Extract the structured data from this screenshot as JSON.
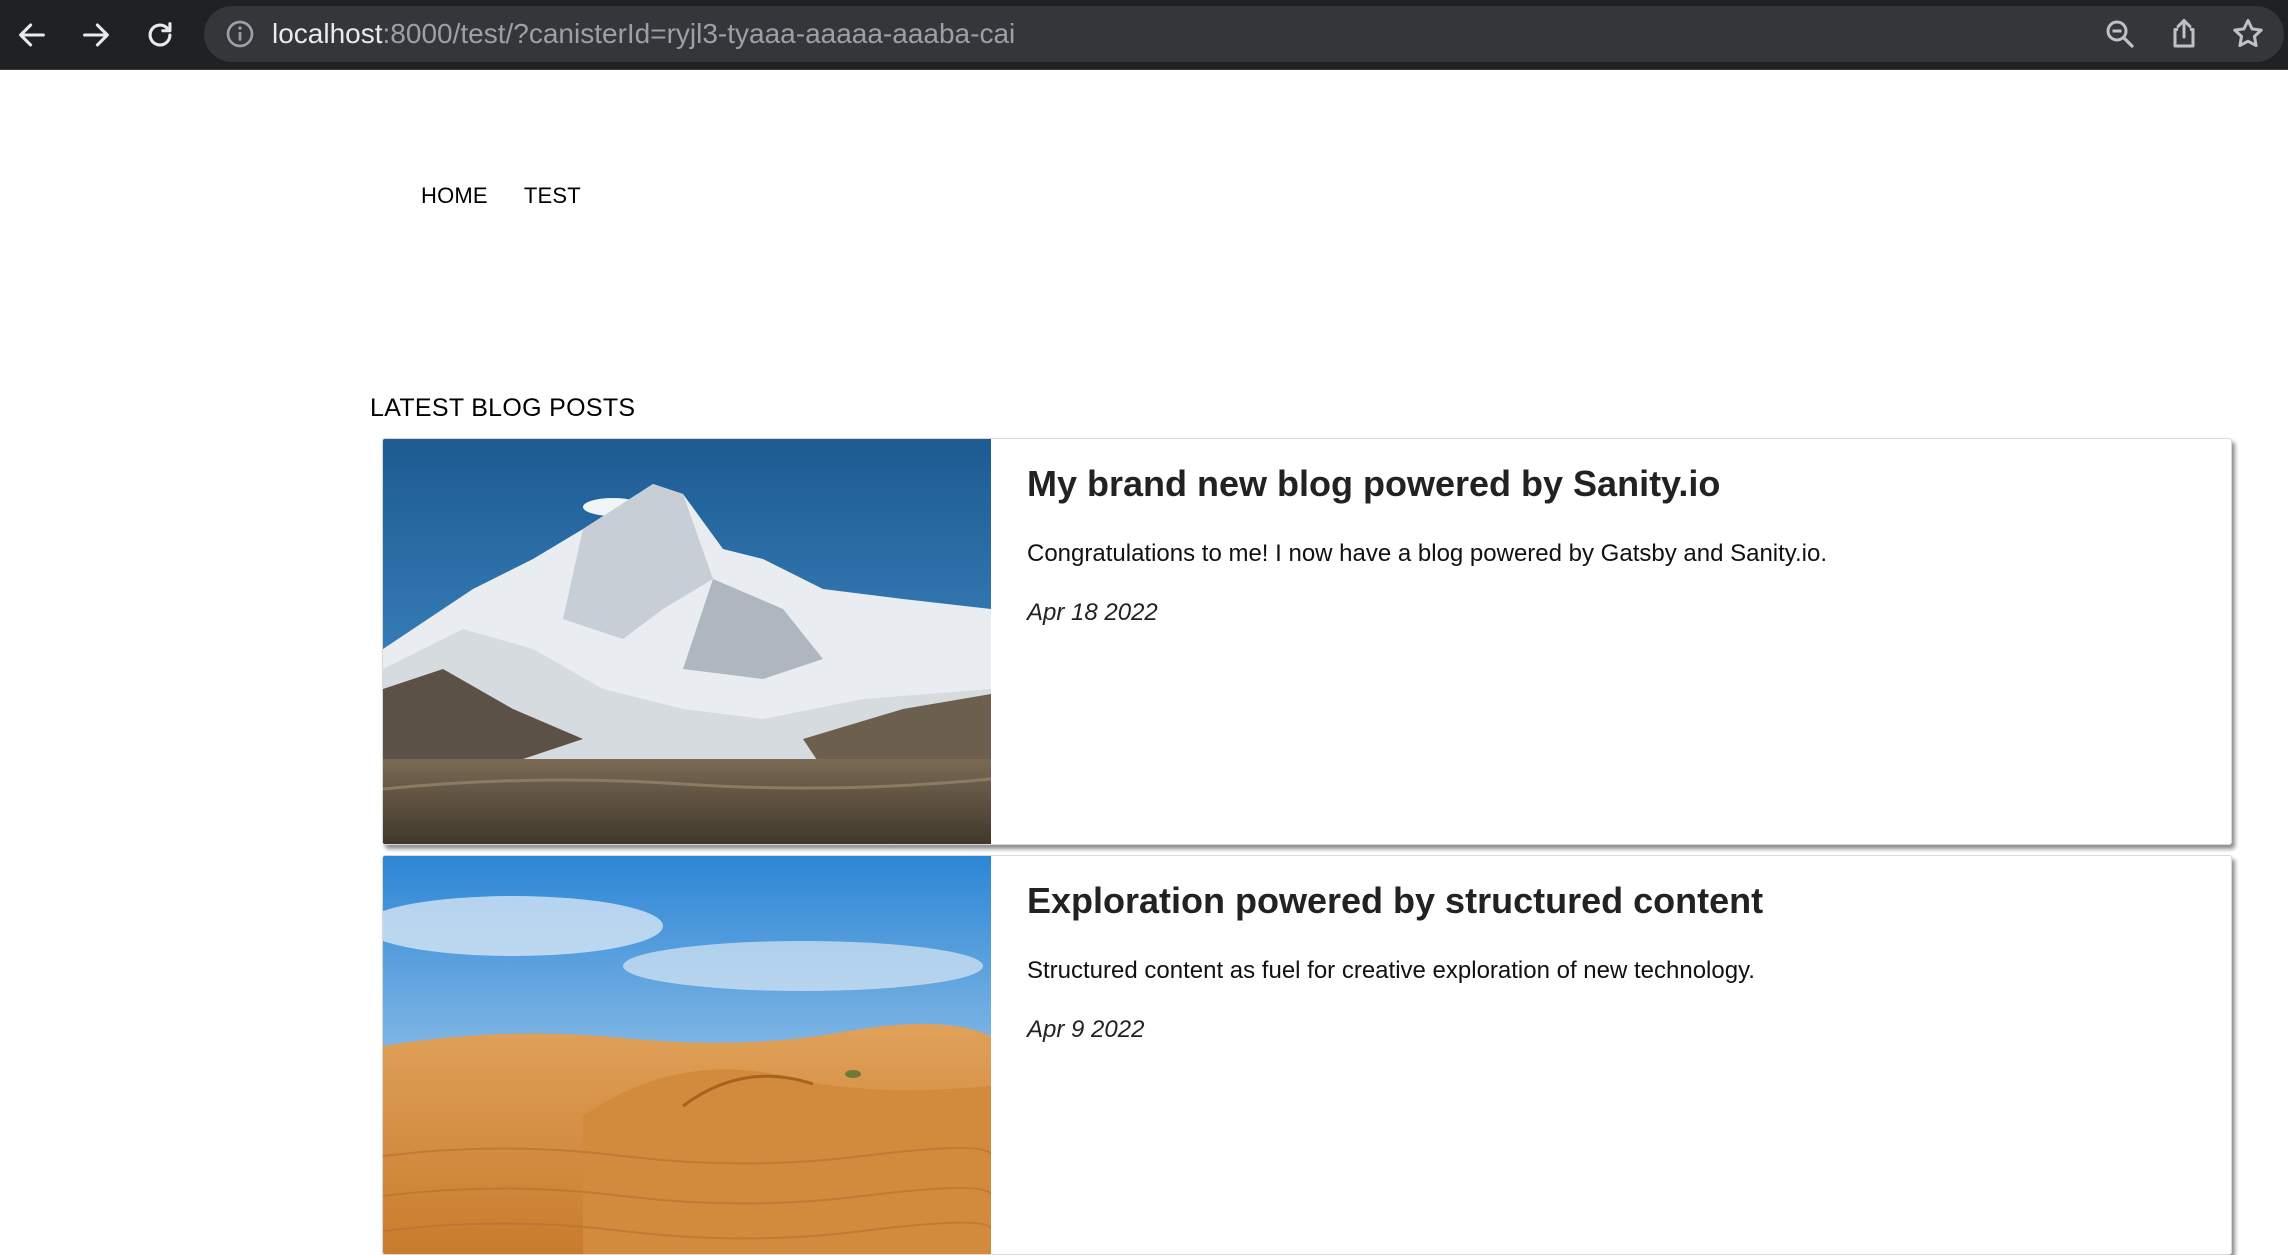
{
  "browser": {
    "url_host": "localhost",
    "url_rest": ":8000/test/?canisterId=ryjl3-tyaaa-aaaaa-aaaba-cai",
    "icons": [
      "back-icon",
      "forward-icon",
      "reload-icon",
      "info-icon",
      "zoom-icon",
      "share-icon",
      "bookmark-star-icon"
    ]
  },
  "nav": {
    "items": [
      {
        "label": "HOME"
      },
      {
        "label": "TEST"
      }
    ]
  },
  "blog": {
    "heading": "LATEST BLOG POSTS",
    "posts": [
      {
        "title": "My brand new blog powered by Sanity.io",
        "excerpt": "Congratulations to me! I now have a blog powered by Gatsby and Sanity.io.",
        "date": "Apr 18 2022",
        "image": "mountain-photo"
      },
      {
        "title": "Exploration powered by structured content",
        "excerpt": "Structured content as fuel for creative exploration of new technology.",
        "date": "Apr 9 2022",
        "image": "desert-photo"
      }
    ]
  }
}
